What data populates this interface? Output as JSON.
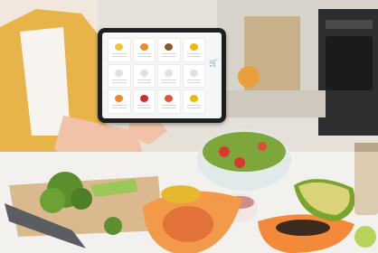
{
  "scene": {
    "description_colors": {
      "shirt": "#e8b44a",
      "tablet": "#1d1f22",
      "screen": "#f6f6f4",
      "counter": "#f2f1ee",
      "board": "#d9b98d",
      "papaya": "#f29a4a",
      "avocado": "#7aa52d"
    }
  },
  "tablet_app": {
    "tiles": [
      {
        "color": "#f4c430"
      },
      {
        "color": "#f08a24"
      },
      {
        "color": "#8b5a2b"
      },
      {
        "color": "#f2b705"
      },
      {
        "color": "#e0e0e0"
      },
      {
        "color": "#e0e0e0"
      },
      {
        "color": "#e0e0e0"
      },
      {
        "color": "#e0e0e0"
      },
      {
        "color": "#f08a24"
      },
      {
        "color": "#d62828"
      },
      {
        "color": "#e4572e"
      },
      {
        "color": "#f2b705"
      }
    ],
    "cart_icon": "cart-icon"
  }
}
